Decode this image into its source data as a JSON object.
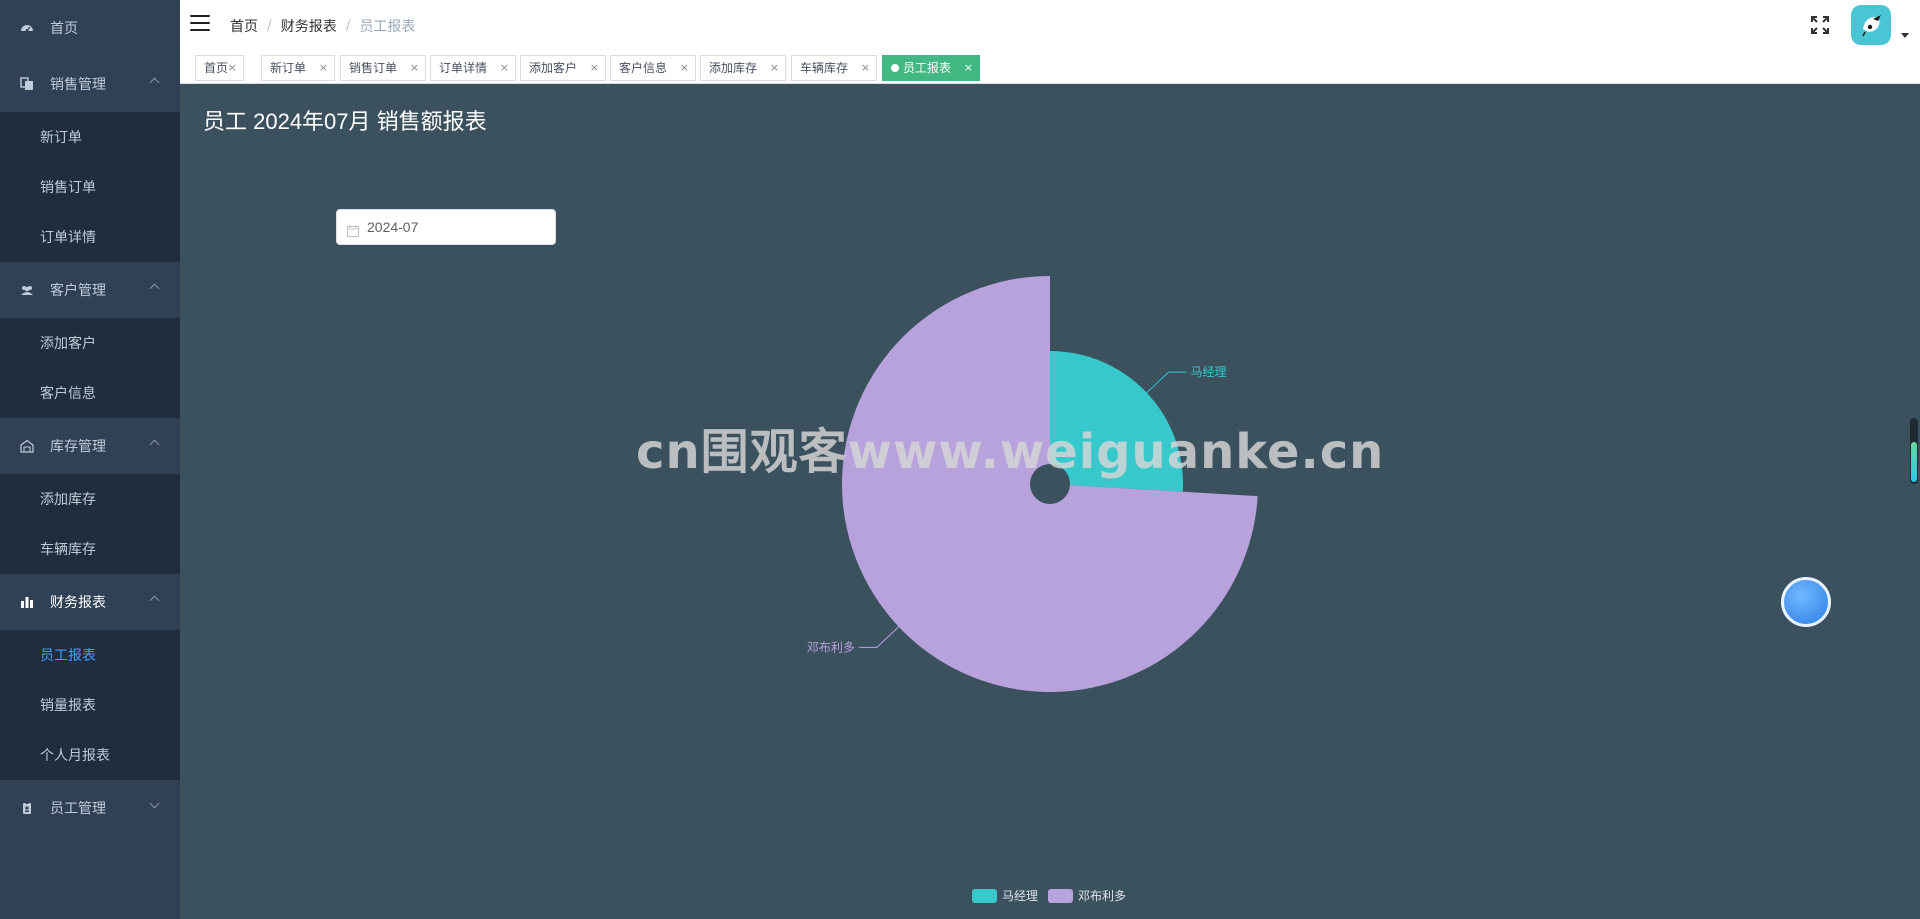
{
  "sidebar": {
    "home": {
      "label": "首页",
      "icon": "dashboard-icon"
    },
    "groups": [
      {
        "label": "销售管理",
        "icon": "copy-icon",
        "expanded": true,
        "items": [
          {
            "label": "新订单"
          },
          {
            "label": "销售订单"
          },
          {
            "label": "订单详情"
          }
        ]
      },
      {
        "label": "客户管理",
        "icon": "users-icon",
        "expanded": true,
        "items": [
          {
            "label": "添加客户"
          },
          {
            "label": "客户信息"
          }
        ]
      },
      {
        "label": "库存管理",
        "icon": "warehouse-icon",
        "expanded": true,
        "items": [
          {
            "label": "添加库存"
          },
          {
            "label": "车辆库存"
          }
        ]
      },
      {
        "label": "财务报表",
        "icon": "bar-chart-icon",
        "expanded": true,
        "items": [
          {
            "label": "员工报表",
            "active": true
          },
          {
            "label": "销量报表"
          },
          {
            "label": "个人月报表"
          }
        ]
      },
      {
        "label": "员工管理",
        "icon": "badge-icon",
        "expanded": false,
        "items": []
      }
    ],
    "colors": {
      "background": "#304156",
      "submenu": "#1f2d3d",
      "text": "#bfcbd9",
      "active": "#409eff"
    }
  },
  "navbar": {
    "breadcrumb": [
      "首页",
      "财务报表",
      "员工报表"
    ]
  },
  "tags": [
    {
      "label": "首页",
      "close": "×"
    },
    {
      "label": "新订单",
      "close": "×"
    },
    {
      "label": "销售订单",
      "close": "×"
    },
    {
      "label": "订单详情",
      "close": "×"
    },
    {
      "label": "添加客户",
      "close": "×"
    },
    {
      "label": "客户信息",
      "close": "×"
    },
    {
      "label": "添加库存",
      "close": "×"
    },
    {
      "label": "车辆库存",
      "close": "×"
    },
    {
      "label": "员工报表",
      "close": "×",
      "active": true
    }
  ],
  "main": {
    "title": "员工 2024年07月 销售额报表",
    "month_picker": {
      "value": "2024-07"
    },
    "watermark": "cn围观客www.weiguanke.cn",
    "background": "#3c515e"
  },
  "chart_data": {
    "type": "pie",
    "variant": "nightingale-rose",
    "title": "",
    "slices": [
      {
        "name": "马经理",
        "value": 35,
        "color": "#37c8cc"
      },
      {
        "name": "邓布利多",
        "value": 100,
        "color": "#b7a2dc"
      }
    ],
    "legend": {
      "position": "bottom-center",
      "entries": [
        "马经理",
        "邓布利多"
      ]
    }
  }
}
